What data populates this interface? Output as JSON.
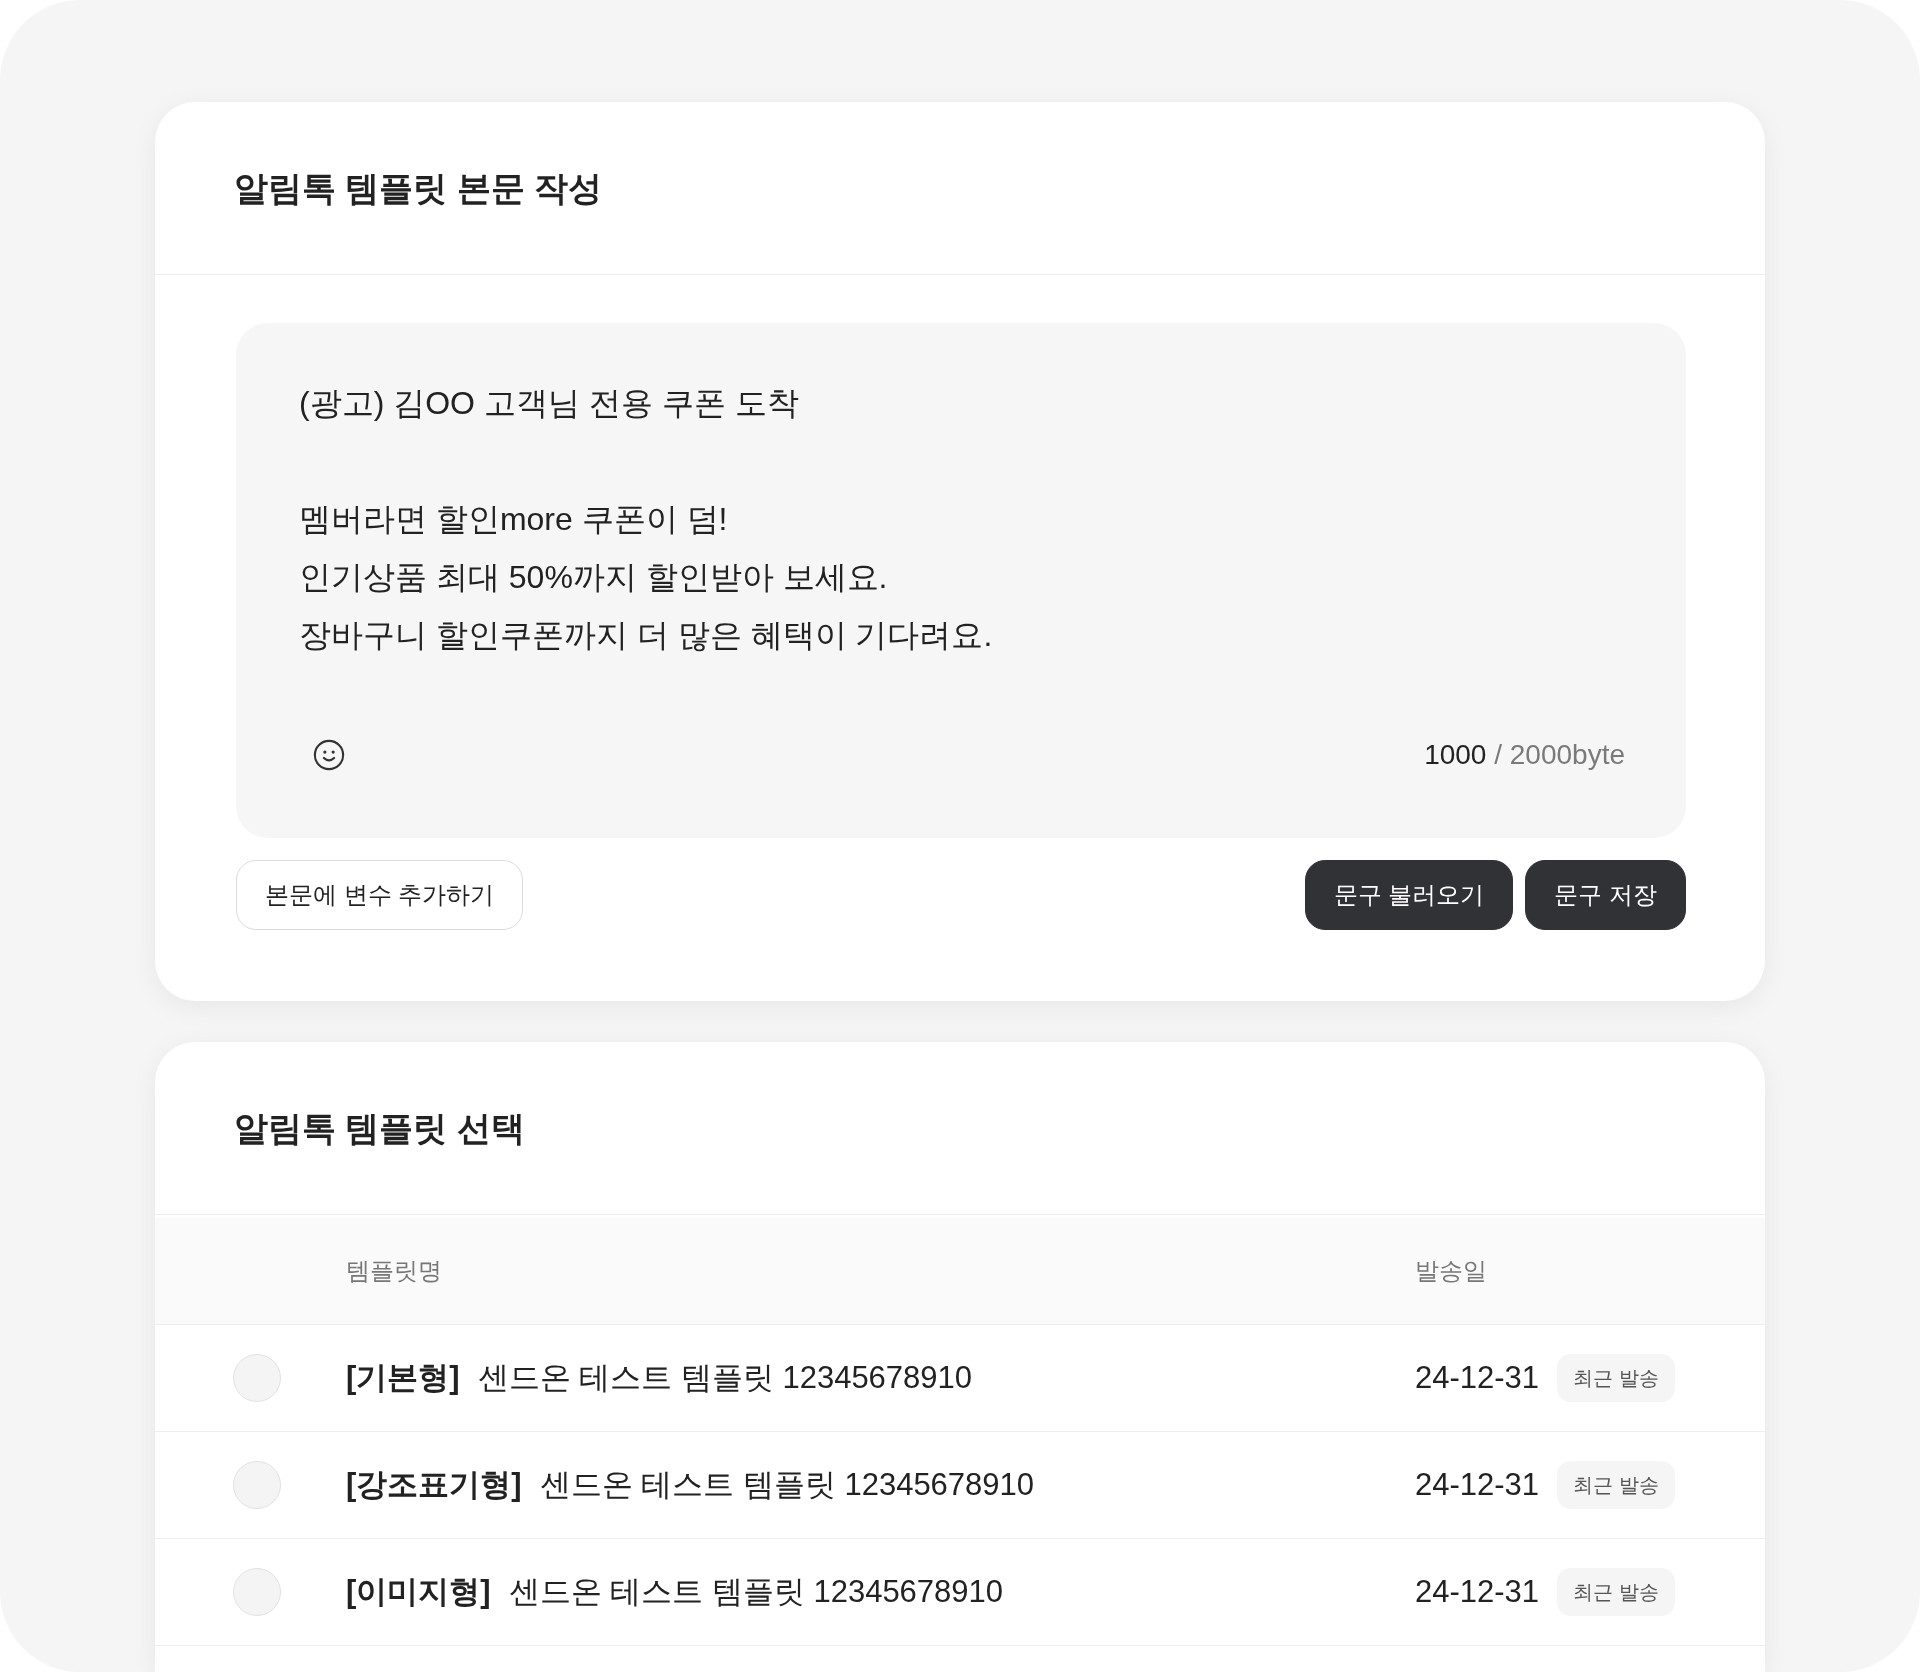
{
  "editor_card": {
    "title": "알림톡 템플릿 본문 작성",
    "message": {
      "paragraphs": [
        [
          "(광고) 김OO 고객님 전용 쿠폰 도착"
        ],
        [
          "멤버라면 할인more 쿠폰이 덤!",
          "인기상품 최대 50%까지 할인받아 보세요.",
          "장바구니 할인쿠폰까지 더 많은 혜택이 기다려요."
        ]
      ]
    },
    "byte_counter": {
      "used": "1000",
      "limit": "/ 2000byte"
    },
    "actions_left": [
      {
        "label": "본문에 변수 추가하기",
        "kind": "outline"
      }
    ],
    "actions_right": [
      {
        "label": "문구 불러오기",
        "kind": "dark"
      },
      {
        "label": "문구 저장",
        "kind": "dark"
      }
    ]
  },
  "template_card": {
    "title": "알림톡 템플릿 선택",
    "table": {
      "columns": [
        "템플릿명",
        "발송일"
      ],
      "rows": [
        {
          "selected": false,
          "type": "[기본형]",
          "name": "센드온 테스트 템플릿 12345678910",
          "date": "24-12-31",
          "tag": "최근 발송"
        },
        {
          "selected": false,
          "type": "[강조표기형]",
          "name": "센드온 테스트 템플릿 12345678910",
          "date": "24-12-31",
          "tag": "최근 발송"
        },
        {
          "selected": false,
          "type": "[이미지형]",
          "name": "센드온 테스트 템플릿 12345678910",
          "date": "24-12-31",
          "tag": "최근 발송"
        }
      ]
    }
  }
}
